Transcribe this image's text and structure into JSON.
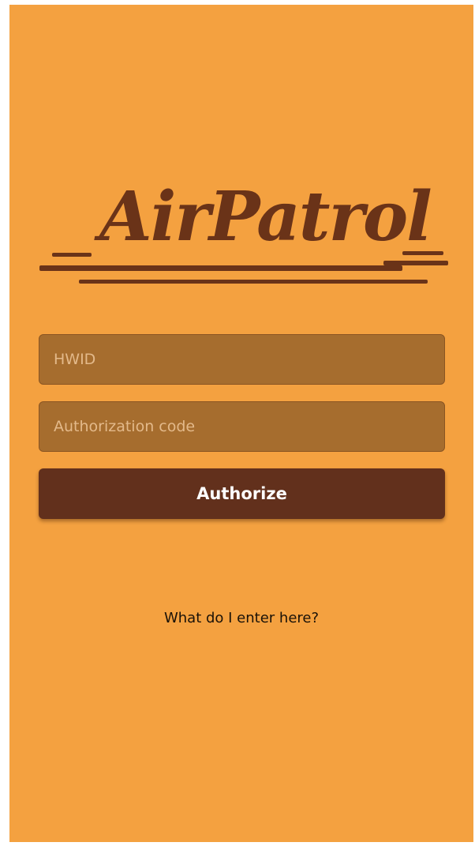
{
  "app": {
    "logo_text": "AirPatrol"
  },
  "form": {
    "hwid_placeholder": "HWID",
    "hwid_value": "",
    "auth_placeholder": "Authorization code",
    "auth_value": "",
    "submit_label": "Authorize",
    "help_link": "What do I enter here?"
  },
  "colors": {
    "background": "#f4a140",
    "brand": "#6a3318",
    "button": "#62301c",
    "field": "#a66d2e"
  }
}
